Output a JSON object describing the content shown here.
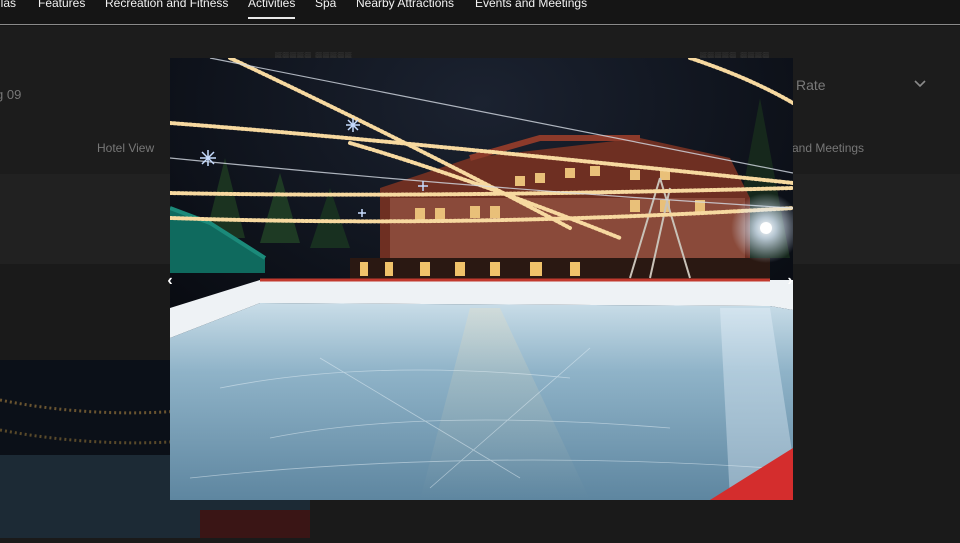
{
  "nav": {
    "items": [
      {
        "label": "llas"
      },
      {
        "label": "Features"
      },
      {
        "label": "Recreation and Fitness"
      },
      {
        "label": "Activities",
        "active": true
      },
      {
        "label": "Spa"
      },
      {
        "label": "Nearby Attractions"
      },
      {
        "label": "Events and Meetings"
      }
    ]
  },
  "background": {
    "date_fragment": "g 09",
    "rate_label": "Rate",
    "hotel_view_label": "Hotel View",
    "meetings_label": "and Meetings"
  },
  "modal": {
    "image_icon": "ice-rink-photo",
    "prev_icon": "chevron-left-icon",
    "next_icon": "chevron-right-icon"
  },
  "colors": {
    "nav_bg": "#151515",
    "overlay_bg": "#141414",
    "rink_ice": "#9fc3d8",
    "lights": "#f7d9a0",
    "building": "#7a3b2c"
  }
}
